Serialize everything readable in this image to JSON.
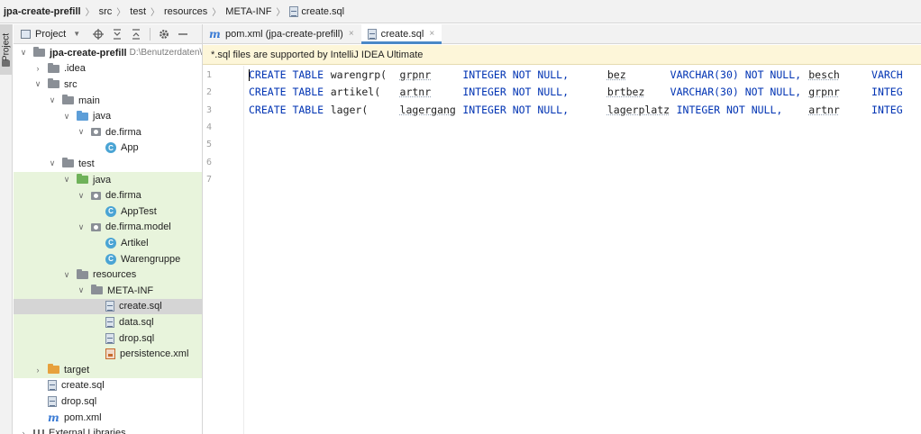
{
  "breadcrumb": {
    "project": "jpa-create-prefill",
    "items": [
      "src",
      "test",
      "resources",
      "META-INF"
    ],
    "file": "create.sql"
  },
  "toolstrip": {
    "project_label": "Project"
  },
  "project_panel": {
    "title": "Project"
  },
  "tree": [
    {
      "label": "jpa-create-prefill",
      "sub": "D:\\Benutzerdaten\\",
      "icon": "folder-gray",
      "arrow": "down",
      "bold": true,
      "depth": 0
    },
    {
      "label": ".idea",
      "icon": "folder-gray",
      "arrow": "right",
      "depth": 1
    },
    {
      "label": "src",
      "icon": "folder-gray",
      "arrow": "down",
      "depth": 1
    },
    {
      "label": "main",
      "icon": "folder-gray",
      "arrow": "down",
      "depth": 2
    },
    {
      "label": "java",
      "icon": "folder-blue",
      "arrow": "down",
      "depth": 3
    },
    {
      "label": "de.firma",
      "icon": "package",
      "arrow": "down",
      "depth": 4
    },
    {
      "label": "App",
      "icon": "class",
      "arrow": "none",
      "depth": 5
    },
    {
      "label": "test",
      "icon": "folder-gray",
      "arrow": "down",
      "depth": 2
    },
    {
      "label": "java",
      "icon": "folder-green",
      "arrow": "down",
      "depth": 3,
      "highlight": true
    },
    {
      "label": "de.firma",
      "icon": "package",
      "arrow": "down",
      "depth": 4,
      "highlight": true
    },
    {
      "label": "AppTest",
      "icon": "class",
      "arrow": "none",
      "depth": 5,
      "highlight": true
    },
    {
      "label": "de.firma.model",
      "icon": "package",
      "arrow": "down",
      "depth": 4,
      "highlight": true
    },
    {
      "label": "Artikel",
      "icon": "class",
      "arrow": "none",
      "depth": 5,
      "highlight": true
    },
    {
      "label": "Warengruppe",
      "icon": "class",
      "arrow": "none",
      "depth": 5,
      "highlight": true
    },
    {
      "label": "resources",
      "icon": "folder-res",
      "arrow": "down",
      "depth": 3,
      "highlight": true
    },
    {
      "label": "META-INF",
      "icon": "folder-gray",
      "arrow": "down",
      "depth": 4,
      "highlight": true
    },
    {
      "label": "create.sql",
      "icon": "sql",
      "arrow": "none",
      "depth": 5,
      "selected": true
    },
    {
      "label": "data.sql",
      "icon": "sql",
      "arrow": "none",
      "depth": 5,
      "highlight": true
    },
    {
      "label": "drop.sql",
      "icon": "sql",
      "arrow": "none",
      "depth": 5,
      "highlight": true
    },
    {
      "label": "persistence.xml",
      "icon": "xml",
      "arrow": "none",
      "depth": 5,
      "highlight": true
    },
    {
      "label": "target",
      "icon": "folder-orange",
      "arrow": "right",
      "depth": 1,
      "highlight": true
    },
    {
      "label": "create.sql",
      "icon": "sql",
      "arrow": "none",
      "depth": 1
    },
    {
      "label": "drop.sql",
      "icon": "sql",
      "arrow": "none",
      "depth": 1
    },
    {
      "label": "pom.xml",
      "icon": "maven",
      "arrow": "none",
      "depth": 1
    },
    {
      "label": "External Libraries",
      "icon": "libs",
      "arrow": "right",
      "depth": 0
    }
  ],
  "tabs": [
    {
      "label": "pom.xml (jpa-create-prefill)",
      "icon": "maven",
      "active": false
    },
    {
      "label": "create.sql",
      "icon": "sql",
      "active": true
    }
  ],
  "notice": {
    "text": "*.sql files are supported by IntelliJ IDEA Ultimate"
  },
  "editor": {
    "line_numbers": [
      "1",
      "2",
      "3",
      "4",
      "5",
      "6",
      "7"
    ],
    "lines": [
      [
        {
          "t": "CREATE TABLE",
          "k": "kw",
          "c": 0
        },
        {
          "t": "warengrp(",
          "k": "id",
          "c": 13
        },
        {
          "t": "grpnr",
          "k": "id",
          "c": 24,
          "u": true
        },
        {
          "t": "INTEGER NOT NULL,",
          "k": "kw",
          "c": 34
        },
        {
          "t": "bez",
          "k": "id",
          "c": 57,
          "u": true
        },
        {
          "t": "VARCHAR(30) NOT NULL,",
          "k": "kw",
          "c": 67
        },
        {
          "t": "besch",
          "k": "id",
          "c": 89,
          "u": true
        },
        {
          "t": "VARCH",
          "k": "kw",
          "c": 99
        }
      ],
      [
        {
          "t": "CREATE TABLE",
          "k": "kw",
          "c": 0
        },
        {
          "t": "artikel(",
          "k": "id",
          "c": 13
        },
        {
          "t": "artnr",
          "k": "id",
          "c": 24,
          "u": true
        },
        {
          "t": "INTEGER NOT NULL,",
          "k": "kw",
          "c": 34
        },
        {
          "t": "brtbez",
          "k": "id",
          "c": 57,
          "u": true
        },
        {
          "t": "VARCHAR(30) NOT NULL,",
          "k": "kw",
          "c": 67
        },
        {
          "t": "grpnr",
          "k": "id",
          "c": 89,
          "u": true
        },
        {
          "t": "INTEG",
          "k": "kw",
          "c": 99
        }
      ],
      [
        {
          "t": "CREATE TABLE",
          "k": "kw",
          "c": 0
        },
        {
          "t": "lager(",
          "k": "id",
          "c": 13
        },
        {
          "t": "lagergang",
          "k": "id",
          "c": 24,
          "u": true
        },
        {
          "t": "INTEGER NOT NULL,",
          "k": "kw",
          "c": 34
        },
        {
          "t": "lagerplatz",
          "k": "id",
          "c": 57,
          "u": true
        },
        {
          "t": "INTEGER NOT NULL,",
          "k": "kw",
          "c": 68
        },
        {
          "t": "artnr",
          "k": "id",
          "c": 89,
          "u": true
        },
        {
          "t": "INTEG",
          "k": "kw",
          "c": 99
        }
      ]
    ]
  },
  "colors": {
    "keyword": "#0033b3",
    "accent": "#4a88c7",
    "highlight": "#e8f4dc",
    "notice": "#fdf6d9"
  }
}
